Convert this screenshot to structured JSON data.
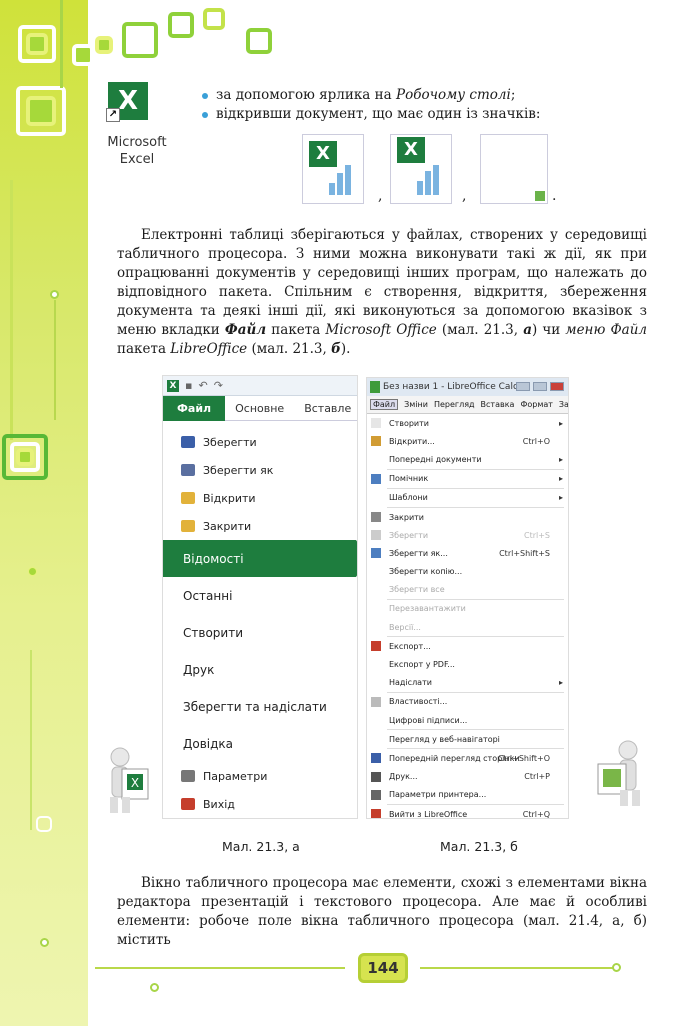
{
  "shortcut": {
    "label_line1": "Microsoft",
    "label_line2": "Excel",
    "icon": "excel-shortcut-icon"
  },
  "bullets": [
    {
      "text_before": "за допомогою ярлика на ",
      "text_italic": "Робочому столі",
      ";": ";",
      "text_after": ";"
    },
    {
      "text": "відкривши документ, що має один із значків:"
    }
  ],
  "file_icons": [
    "excel-xls-icon",
    "excel-xlsx-icon",
    "libreoffice-ods-icon"
  ],
  "paragraph1": {
    "t1": "Електронні таблиці зберігаються у файлах, створених у середовищі табличного процесора. З ними можна виконувати такі ж дії, як при опрацюванні документів у середовищі інших програм, що належать до відповідного пакета. Спільним є створення, відкриття, збереження документа та деякі інші дії, які виконуються за допомогою вказівок з меню вкладки ",
    "b1": "Файл",
    "t2": " пакета ",
    "i1": "Microsoft Office",
    "t3": " (мал. 21.3, ",
    "i2": "а",
    "t4": ") чи ",
    "i3": "меню Файл",
    "t5": " пакета ",
    "i4": "LibreOffice",
    "t6": " (мал. 21.3, ",
    "i5": "б",
    "t7": ")."
  },
  "office_window": {
    "tabs": {
      "file": "Файл",
      "home": "Основне",
      "insert": "Вставле"
    },
    "items": [
      {
        "label": "Зберегти",
        "icon": "save-icon",
        "color": "#3b5fa8"
      },
      {
        "label": "Зберегти як",
        "icon": "save-as-icon",
        "color": "#5a6fa0"
      },
      {
        "label": "Відкрити",
        "icon": "open-folder-icon",
        "color": "#e2b23a"
      },
      {
        "label": "Закрити",
        "icon": "close-folder-icon",
        "color": "#e2b23a"
      }
    ],
    "big_items": [
      "Відомості",
      "Останні",
      "Створити",
      "Друк",
      "Зберегти та надіслати",
      "Довідка"
    ],
    "footer_items": [
      {
        "label": "Параметри",
        "icon": "options-icon",
        "color": "#777"
      },
      {
        "label": "Вихід",
        "icon": "exit-icon",
        "color": "#c53e2c"
      }
    ]
  },
  "calc_window": {
    "title": "Без назви 1 - LibreOffice Calc",
    "menu": [
      "Файл",
      "Зміни",
      "Перегляд",
      "Вставка",
      "Формат",
      "Засоб"
    ],
    "items": [
      {
        "label": "Створити",
        "shortcut": "",
        "sub": "▸",
        "dis": false,
        "color": "#e6e6e6"
      },
      {
        "label": "Відкрити...",
        "shortcut": "Ctrl+O",
        "sub": "",
        "dis": false,
        "color": "#d19c34"
      },
      {
        "label": "Попередні документи",
        "shortcut": "",
        "sub": "▸",
        "dis": false,
        "color": ""
      },
      {
        "sep": true
      },
      {
        "label": "Помічник",
        "shortcut": "",
        "sub": "▸",
        "dis": false,
        "color": "#4d7ec0"
      },
      {
        "sep": true
      },
      {
        "label": "Шаблони",
        "shortcut": "",
        "sub": "▸",
        "dis": false,
        "color": ""
      },
      {
        "sep": true
      },
      {
        "label": "Закрити",
        "shortcut": "",
        "sub": "",
        "dis": false,
        "color": "#888"
      },
      {
        "label": "Зберегти",
        "shortcut": "Ctrl+S",
        "sub": "",
        "dis": true,
        "color": "#ccc"
      },
      {
        "label": "Зберегти як...",
        "shortcut": "Ctrl+Shift+S",
        "sub": "",
        "dis": false,
        "color": "#4d7ec0"
      },
      {
        "label": "Зберегти копію...",
        "shortcut": "",
        "sub": "",
        "dis": false,
        "color": ""
      },
      {
        "label": "Зберегти все",
        "shortcut": "",
        "sub": "",
        "dis": true,
        "color": ""
      },
      {
        "sep": true
      },
      {
        "label": "Перезавантажити",
        "shortcut": "",
        "sub": "",
        "dis": true,
        "color": ""
      },
      {
        "label": "Версії...",
        "shortcut": "",
        "sub": "",
        "dis": true,
        "color": ""
      },
      {
        "sep": true
      },
      {
        "label": "Експорт...",
        "shortcut": "",
        "sub": "",
        "dis": false,
        "color": "#c53e2c"
      },
      {
        "label": "Експорт у PDF...",
        "shortcut": "",
        "sub": "",
        "dis": false,
        "color": ""
      },
      {
        "label": "Надіслати",
        "shortcut": "",
        "sub": "▸",
        "dis": false,
        "color": ""
      },
      {
        "sep": true
      },
      {
        "label": "Властивості...",
        "shortcut": "",
        "sub": "",
        "dis": false,
        "color": "#bbb"
      },
      {
        "label": "Цифрові підписи...",
        "shortcut": "",
        "sub": "",
        "dis": false,
        "color": ""
      },
      {
        "sep": true
      },
      {
        "label": "Перегляд у веб-навігаторі",
        "shortcut": "",
        "sub": "",
        "dis": false,
        "color": ""
      },
      {
        "sep": true
      },
      {
        "label": "Попередній перегляд сторінки",
        "shortcut": "Ctrl+Shift+O",
        "sub": "",
        "dis": false,
        "color": "#3b5fa8"
      },
      {
        "label": "Друк...",
        "shortcut": "Ctrl+P",
        "sub": "",
        "dis": false,
        "color": "#555"
      },
      {
        "label": "Параметри принтера...",
        "shortcut": "",
        "sub": "",
        "dis": false,
        "color": "#666"
      },
      {
        "sep": true
      },
      {
        "label": "Вийти з LibreOffice",
        "shortcut": "Ctrl+Q",
        "sub": "",
        "dis": false,
        "color": "#c53e2c"
      }
    ]
  },
  "captions": {
    "a": "Мал. 21.3, а",
    "b": "Мал. 21.3, б"
  },
  "paragraph2": {
    "text": "Вікно табличного процесора має елементи, схожі з елементами вікна редактора презентацій і текстового процесора. Але має й особливі елементи: робоче поле вікна табличного процесора (мал. 21.4, а, б) містить"
  },
  "page_number": "144"
}
